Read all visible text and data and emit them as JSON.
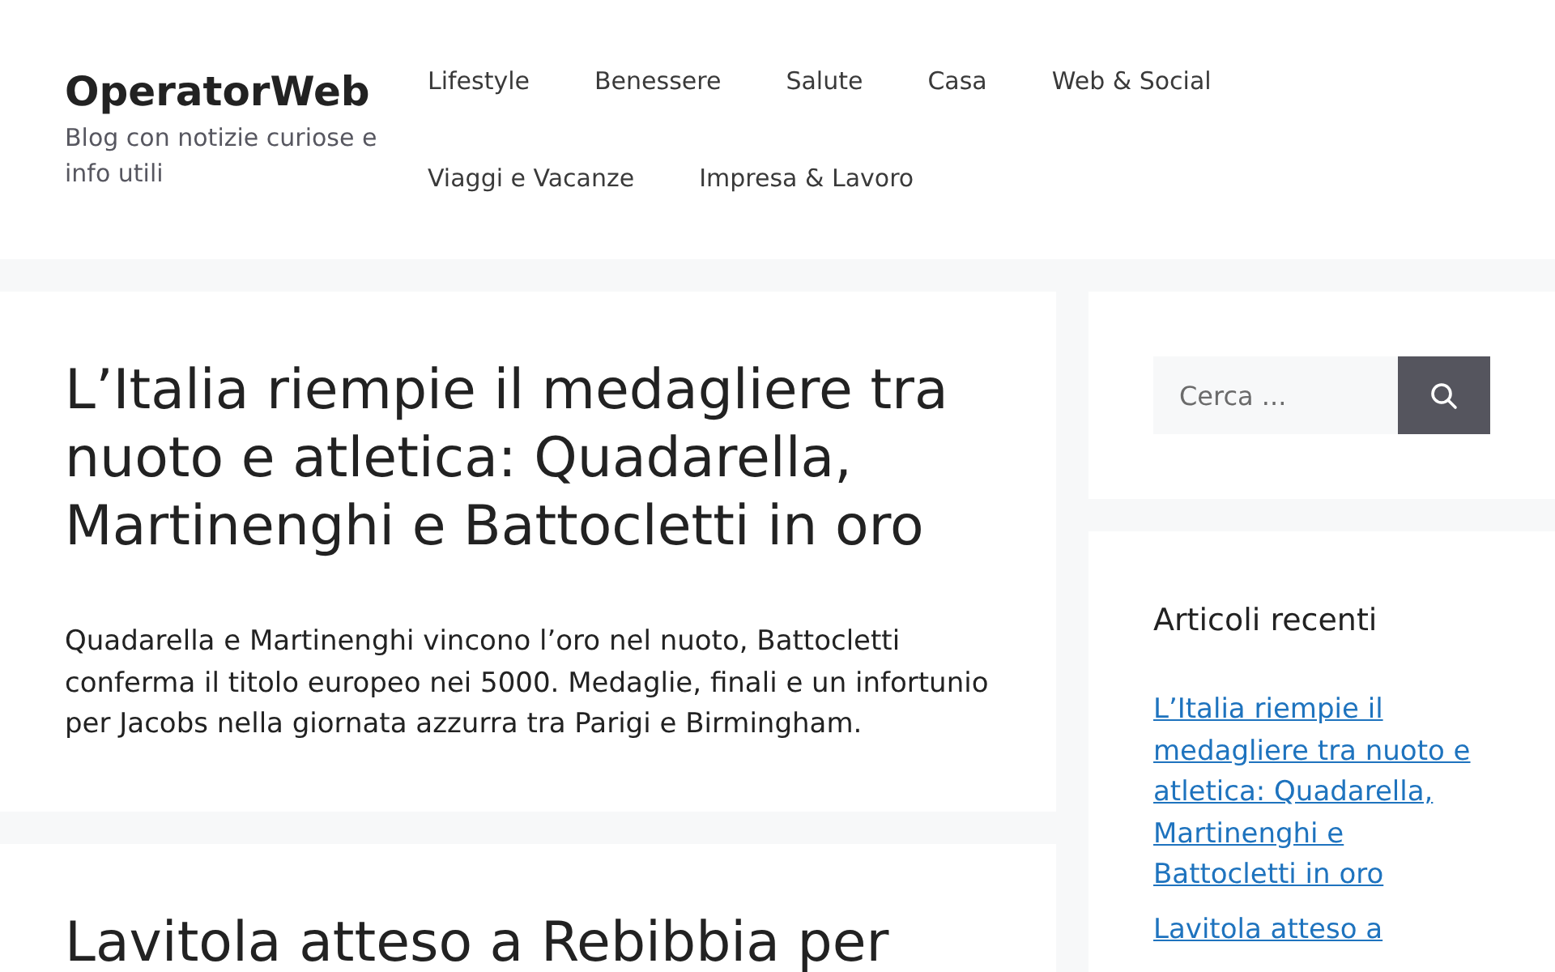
{
  "site": {
    "title": "OperatorWeb",
    "tagline": "Blog con notizie curiose e info utili"
  },
  "nav": [
    "Lifestyle",
    "Benessere",
    "Salute",
    "Casa",
    "Web & Social",
    "Viaggi e Vacanze",
    "Impresa & Lavoro"
  ],
  "articles": [
    {
      "title": "L’Italia riempie il medagliere tra nuoto e atletica: Quadarella, Martinenghi e Battocletti in oro",
      "excerpt": "Quadarella e Martinenghi vincono l’oro nel nuoto, Battocletti conferma il titolo europeo nei 5000. Medaglie, finali e un infortunio per Jacobs nella giornata azzurra tra Parigi e Birmingham."
    },
    {
      "title": "Lavitola atteso a Rebibbia per"
    }
  ],
  "search": {
    "placeholder": "Cerca ..."
  },
  "recent_posts": {
    "title": "Articoli recenti",
    "items": [
      "L’Italia riempie il medagliere tra nuoto e atletica: Quadarella, Martinenghi e Battocletti in oro",
      "Lavitola atteso a"
    ]
  }
}
